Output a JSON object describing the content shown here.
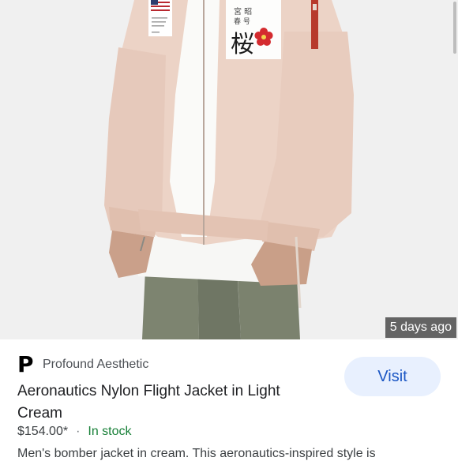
{
  "product_image": {
    "patch_text": "桜",
    "time_badge": "5 days ago"
  },
  "seller": {
    "logo_letter": "P",
    "name": "Profound Aesthetic"
  },
  "visit_label": "Visit",
  "product": {
    "title": "Aeronautics Nylon Flight Jacket in Light Cream",
    "price": "$154.00*",
    "separator": "·",
    "availability": "In stock",
    "description": "Men's bomber jacket in cream. This aeronautics-inspired style is"
  },
  "colors": {
    "visit_bg": "#e8f0fe",
    "visit_text": "#1a56c4",
    "in_stock": "#188038",
    "jacket": "#ecd3c6"
  }
}
